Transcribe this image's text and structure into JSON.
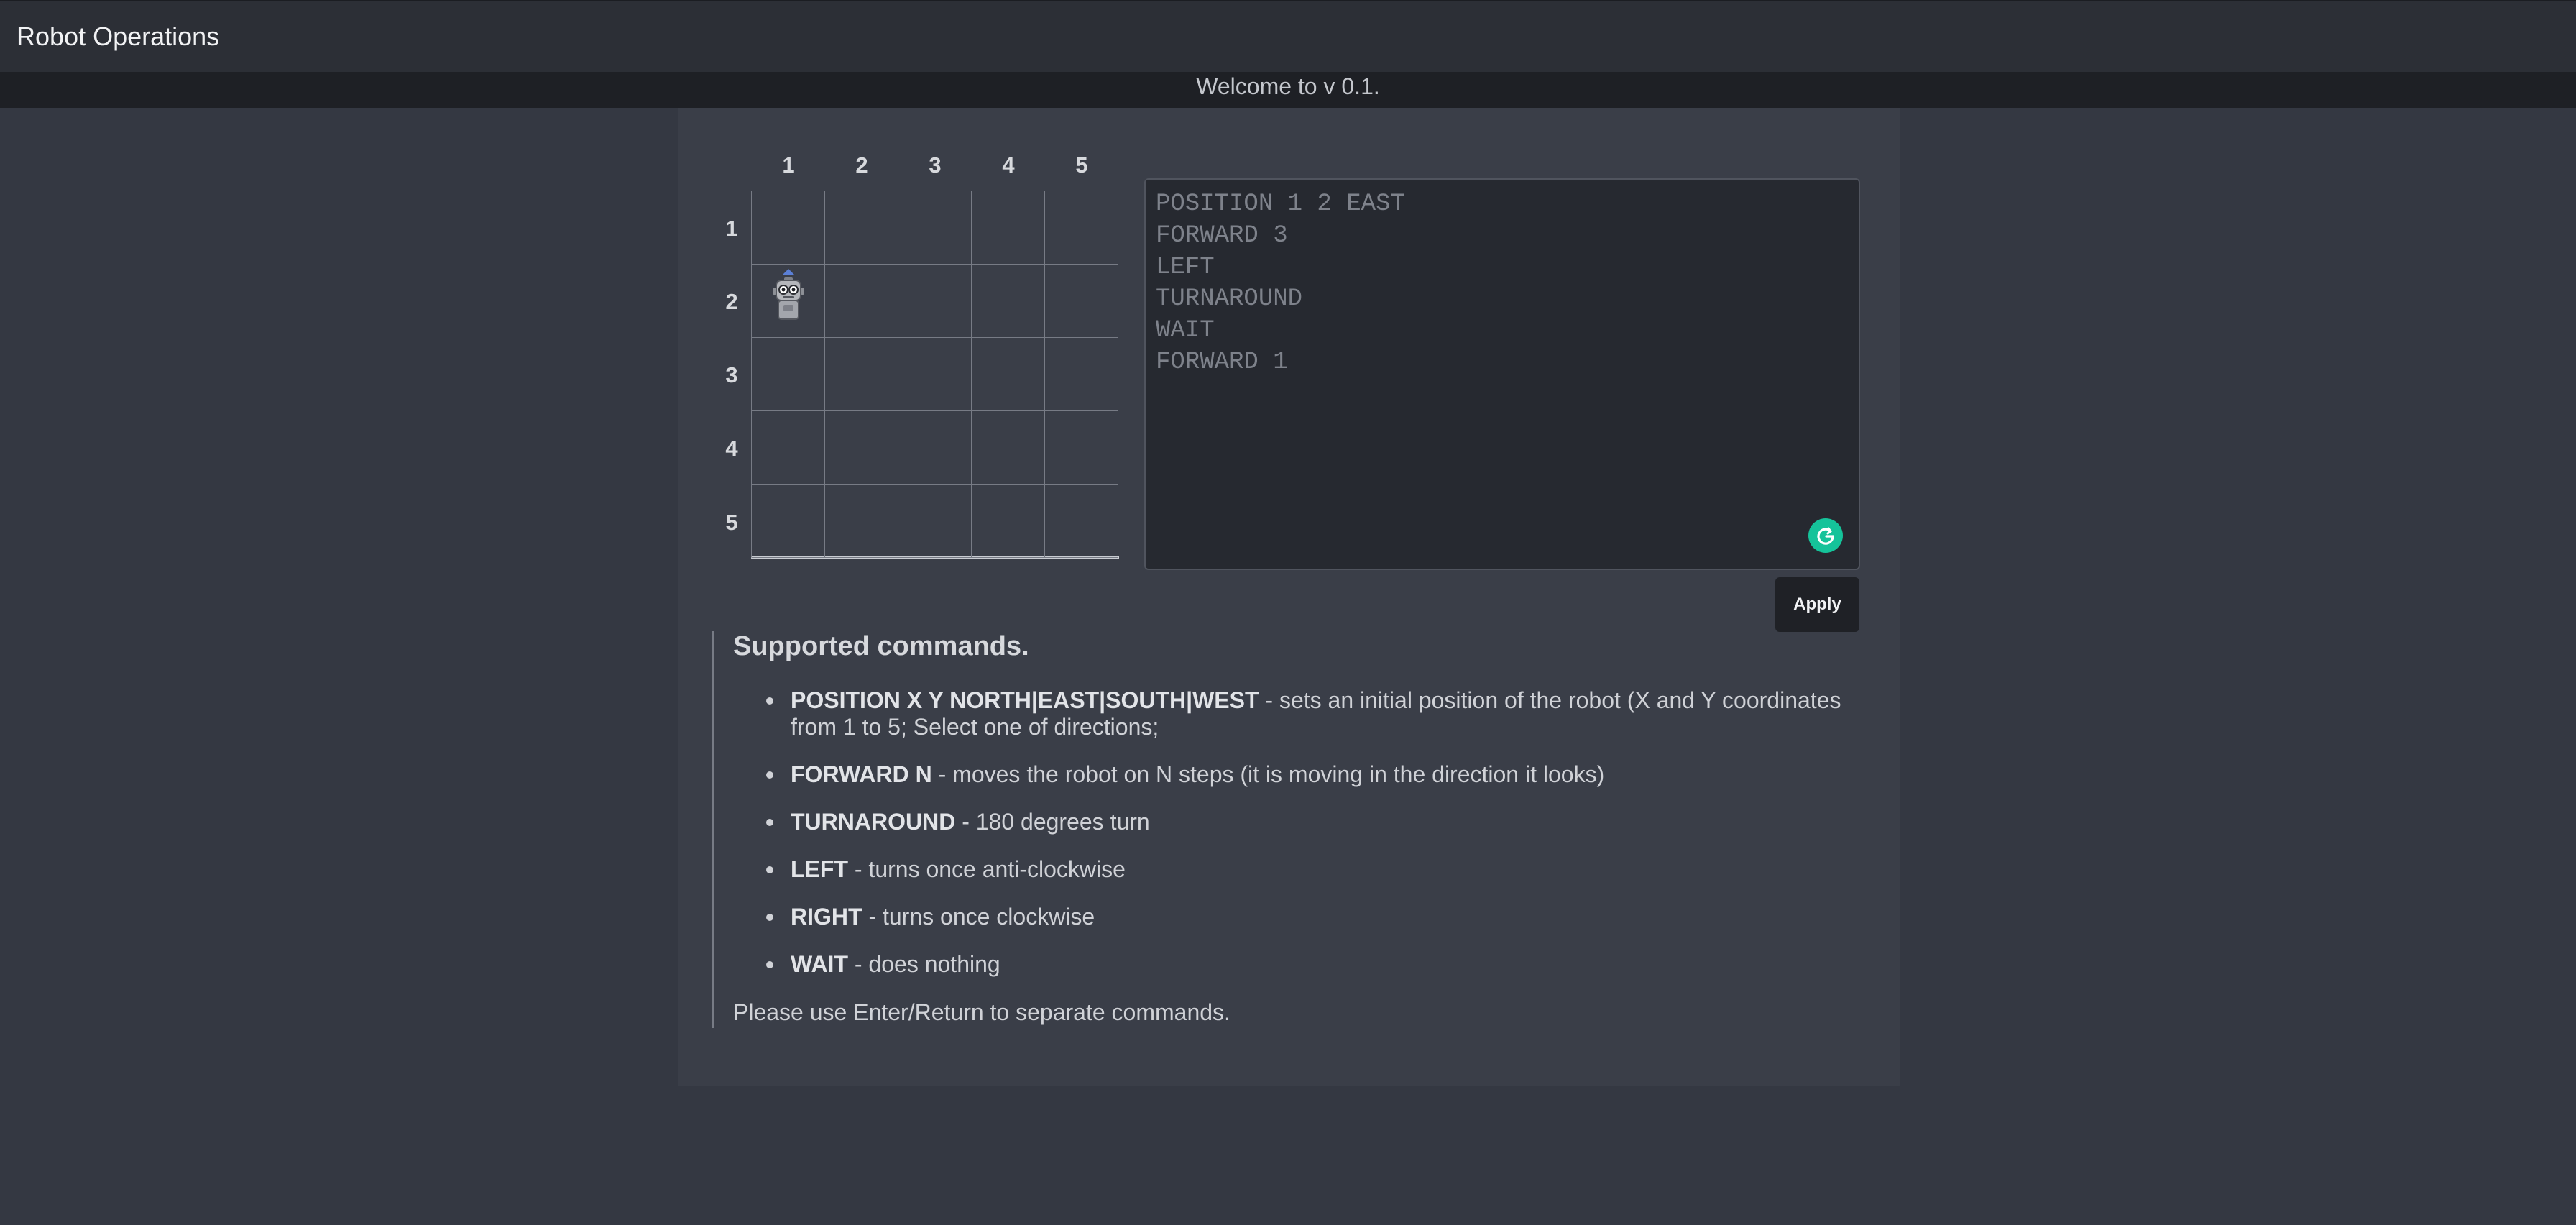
{
  "header": {
    "title": "Robot Operations",
    "welcome": "Welcome to v 0.1."
  },
  "board": {
    "columns": [
      "1",
      "2",
      "3",
      "4",
      "5"
    ],
    "rows": [
      "1",
      "2",
      "3",
      "4",
      "5"
    ],
    "robot": {
      "row": 2,
      "column": 1,
      "facing": "north",
      "icon": "robot-icon"
    }
  },
  "editor": {
    "lines": [
      "POSITION 1 2 EAST",
      "FORWARD 3",
      "LEFT",
      "TURNAROUND",
      "WAIT",
      "FORWARD 1"
    ],
    "assistant_icon": "grammarly-icon"
  },
  "actions": {
    "apply_label": "Apply"
  },
  "help": {
    "title": "Supported commands.",
    "commands": [
      {
        "name": "POSITION X Y NORTH|EAST|SOUTH|WEST",
        "description": " - sets an initial position of the robot (X and Y coordinates from 1 to 5; Select one of directions;"
      },
      {
        "name": "FORWARD N",
        "description": " - moves the robot on N steps (it is moving in the direction it looks)"
      },
      {
        "name": "TURNAROUND",
        "description": " - 180 degrees turn"
      },
      {
        "name": "LEFT",
        "description": " - turns once anti-clockwise"
      },
      {
        "name": "RIGHT",
        "description": " - turns once clockwise"
      },
      {
        "name": "WAIT",
        "description": " - does nothing"
      }
    ],
    "footer": "Please use Enter/Return to separate commands."
  },
  "colors": {
    "background": "#343842",
    "panel": "#3a3e48",
    "topbar": "#2c2f36",
    "welcome_bar": "#1e2025",
    "editor_bg": "#262930",
    "apply_bg": "#1f2126",
    "grammarly": "#15c39a",
    "robot_arrow": "#5b7fd6"
  }
}
